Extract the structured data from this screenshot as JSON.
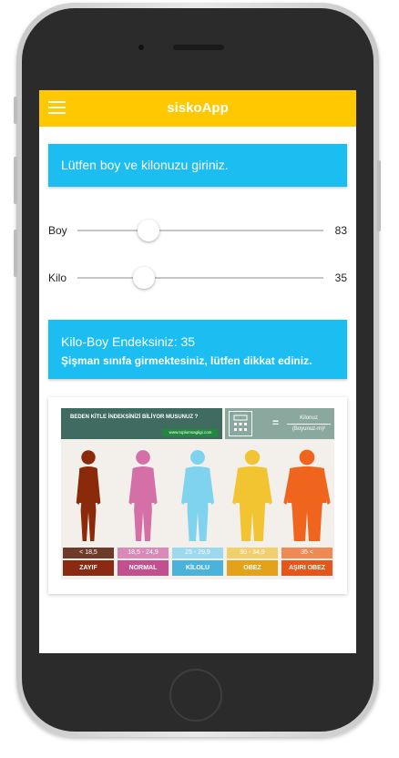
{
  "app": {
    "title": "siskoApp"
  },
  "prompt": {
    "text": "Lütfen boy ve kilonuzu giriniz."
  },
  "sliders": [
    {
      "label": "Boy",
      "value": "83",
      "fraction": 0.29
    },
    {
      "label": "Kilo",
      "value": "35",
      "fraction": 0.27
    }
  ],
  "result": {
    "title": "Kilo-Boy Endeksiniz: 35",
    "message": "Şişman sınıfa girmektesiniz, lütfen dikkat ediniz."
  },
  "bmi_image": {
    "header_title": "BEDEN KİTLE İNDEKSİNİZİ BİLİYOR MUSUNUZ ?",
    "site": "www.toplumsagligi.com",
    "formula_top": "Kilonuz",
    "formula_bottom": "(Boyunuz-m)²",
    "categories": [
      {
        "range": "< 18,5",
        "label": "ZAYIF",
        "color": "#8b2a0a",
        "range_color": "#6e3a2a",
        "label_color": "#8a2a12"
      },
      {
        "range": "18,5 - 24,9",
        "label": "NORMAL",
        "color": "#d46fa8",
        "range_color": "#d98ab6",
        "label_color": "#c2508f"
      },
      {
        "range": "25 - 29,9",
        "label": "KİLOLU",
        "color": "#7fd3ef",
        "range_color": "#9cd8ee",
        "label_color": "#49b3dc"
      },
      {
        "range": "30 - 34,9",
        "label": "OBEZ",
        "color": "#f2c432",
        "range_color": "#f1cf6a",
        "label_color": "#e3a21a"
      },
      {
        "range": "35 <",
        "label": "AŞIRI OBEZ",
        "color": "#f0651e",
        "range_color": "#f08a55",
        "label_color": "#e6561a"
      }
    ]
  }
}
